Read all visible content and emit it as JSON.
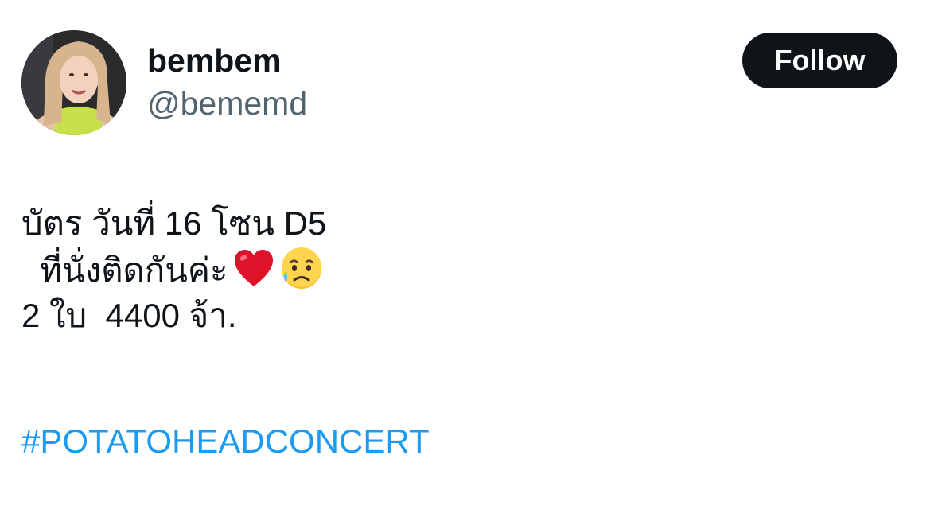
{
  "author": {
    "display_name": "bembem",
    "handle": "@bememd",
    "avatar_icon": "profile-photo"
  },
  "follow_button": {
    "label": "Follow"
  },
  "tweet": {
    "lines": [
      "บัตร วันที่ 16 โซน D5",
      "  ที่นั่งติดกันค่ะ",
      "2 ใบ  4400 จ้า."
    ],
    "emojis": [
      "red-heart-icon",
      "sad-but-relieved-face-icon"
    ],
    "hashtag": "#POTATOHEADCONCERT"
  },
  "colors": {
    "text": "#0f1419",
    "secondary": "#536471",
    "link": "#1d9bf0",
    "button_bg": "#0f1419"
  }
}
